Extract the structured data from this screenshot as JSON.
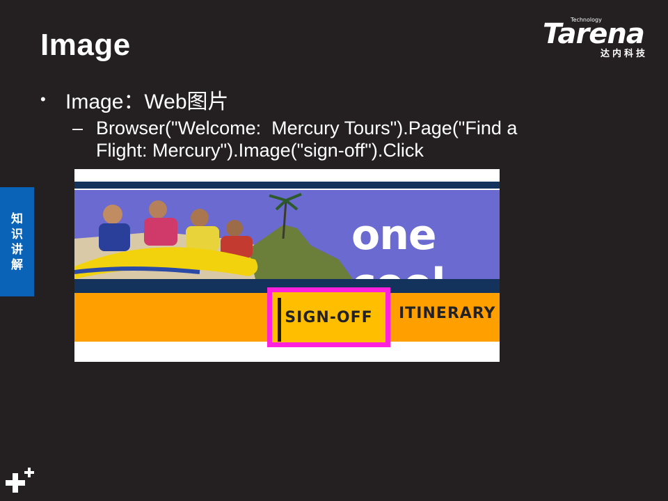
{
  "slide": {
    "title": "Image",
    "bullet": "Image：Web图片",
    "sub_bullet_line1": "Browser(\"Welcome:  Mercury Tours\").Page(\"Find a",
    "sub_bullet_line2": "Flight: Mercury\").Image(\"sign-off\").Click",
    "dash": "–",
    "bullet_symbol": "•"
  },
  "logo": {
    "small": "Technology",
    "main": "Tarena",
    "cn": "达内科技"
  },
  "side_tab": {
    "chars": [
      "知",
      "识",
      "讲",
      "解"
    ],
    "color": "#0a63b6"
  },
  "screenshot": {
    "banner_text": "one cool",
    "signoff_label": "SIGN-OFF",
    "itinerary_label": "ITINERARY",
    "highlight_color": "#ff22dd",
    "nav_color": "#ff9f00"
  },
  "footer": {
    "icon": "plus-icon"
  }
}
